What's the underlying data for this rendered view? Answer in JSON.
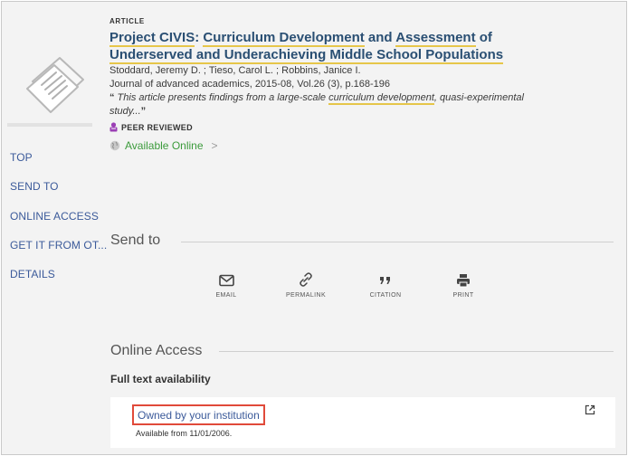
{
  "record": {
    "type": "ARTICLE",
    "title_part1": "Project CIVIS",
    "title_colon": ": ",
    "title_part2": "Curriculum Development",
    "title_part3": " and ",
    "title_part4": "Assessment",
    "title_part5": " of",
    "title_part6": "Underserved and Underachieving Middle School Populations",
    "authors": "Stoddard, Jeremy D. ; Tieso, Carol L. ; Robbins, Janice I.",
    "source": "Journal of advanced academics, 2015-08, Vol.26 (3), p.168-196",
    "snippet_open": "“",
    "snippet_text1": " This article presents findings from a large-scale ",
    "snippet_hl": "curriculum development",
    "snippet_text2": ", quasi-experimental study...",
    "snippet_close": "”",
    "peer_reviewed": "PEER REVIEWED",
    "availability": "Available Online",
    "availability_chevron": ">"
  },
  "leftnav": [
    "TOP",
    "SEND TO",
    "ONLINE ACCESS",
    "GET IT FROM OT...",
    "DETAILS"
  ],
  "send_to": {
    "heading": "Send to",
    "items": [
      {
        "label": "EMAIL",
        "icon": "envelope-icon"
      },
      {
        "label": "PERMALINK",
        "icon": "link-icon"
      },
      {
        "label": "CITATION",
        "icon": "quote-icon"
      },
      {
        "label": "PRINT",
        "icon": "printer-icon"
      }
    ]
  },
  "online_access": {
    "heading": "Online Access",
    "full_text_label": "Full text availability",
    "link_text": "Owned by your institution",
    "available_from": "Available from 11/01/2006.",
    "external_icon": "external-link-icon"
  },
  "colors": {
    "title": "#2a4f73",
    "highlight": "#e6c64a",
    "link": "#3b5a9a",
    "available": "#3c9b3c",
    "outline": "#e04a3a"
  }
}
